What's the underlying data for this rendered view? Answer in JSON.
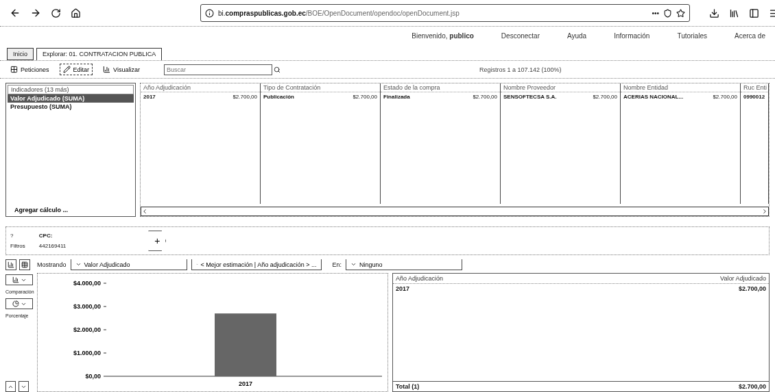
{
  "browser": {
    "url_prefix": "bi.",
    "url_domain": "compraspublicas.gob.ec",
    "url_rest": "/BOE/OpenDocument/opendoc/openDocument.jsp",
    "more": "•••"
  },
  "nav": {
    "welcome": "Bienvenido,",
    "user": "publico",
    "links": [
      "Desconectar",
      "Ayuda",
      "Información",
      "Tutoriales",
      "Acerca de"
    ]
  },
  "tabs": [
    {
      "label": "Inicio",
      "selected": false
    },
    {
      "label": "Explorar: 01. CONTRATACION PUBLICA",
      "selected": true
    }
  ],
  "toolbar": {
    "buttons": [
      {
        "label": "Peticiones",
        "selected": false
      },
      {
        "label": "Editar",
        "selected": true
      },
      {
        "label": "Visualizar",
        "selected": false
      }
    ],
    "search": {
      "placeholder": "Buscar"
    },
    "records": "Registros 1 a 107.142 (100%)"
  },
  "indicators": {
    "title": "Indicadores (13 más)",
    "items": [
      {
        "label": "Valor Adjudicado (SUMA)",
        "selected": true
      },
      {
        "label": "Presupuesto (SUMA)",
        "selected": false
      }
    ],
    "add": "Agregar cálculo ..."
  },
  "facets": [
    {
      "header": "Año Adjudicación",
      "value": "2017",
      "amount": "$2.700,00"
    },
    {
      "header": "Tipo de Contratación",
      "value": "Publicación",
      "amount": "$2.700,00"
    },
    {
      "header": "Estado de la compra",
      "value": "Finalizada",
      "amount": "$2.700,00"
    },
    {
      "header": "Nombre Proveedor",
      "value": "SENSOFTECSA S.A.",
      "amount": "$2.700,00"
    },
    {
      "header": "Nombre Entidad",
      "value": "ACERIAS NACIONAL...",
      "amount": "$2.700,00"
    },
    {
      "header": "Ruc Enti",
      "value": "0990012"
    }
  ],
  "filters": {
    "help": "?",
    "label": "Filtros",
    "name": "CPC:",
    "value": "442169411",
    "add": "+"
  },
  "chart_panel": {
    "showing": "Mostrando",
    "measure": "Valor Adjudicado",
    "dimension": "< Mejor estimación | Año adjudicación > ...",
    "in": "En:",
    "in_value": "Ninguno",
    "left_tools": [
      "Comparación",
      "Porcentaje"
    ],
    "chart_data": {
      "type": "bar",
      "categories": [
        "2017"
      ],
      "values": [
        2700
      ],
      "ylim": [
        0,
        4000
      ],
      "yticks": [
        {
          "value": 0,
          "label": "$0,00"
        },
        {
          "value": 1000,
          "label": "$1.000,00"
        },
        {
          "value": 2000,
          "label": "$2.000,00"
        },
        {
          "value": 3000,
          "label": "$3.000,00"
        },
        {
          "value": 4000,
          "label": "$4.000,00"
        }
      ]
    }
  },
  "table": {
    "columns": [
      "Año Adjudicación",
      "Valor Adjudicado"
    ],
    "rows": [
      [
        "2017",
        "$2.700,00"
      ]
    ],
    "total": [
      "Total (1)",
      "$2.700,00"
    ]
  }
}
